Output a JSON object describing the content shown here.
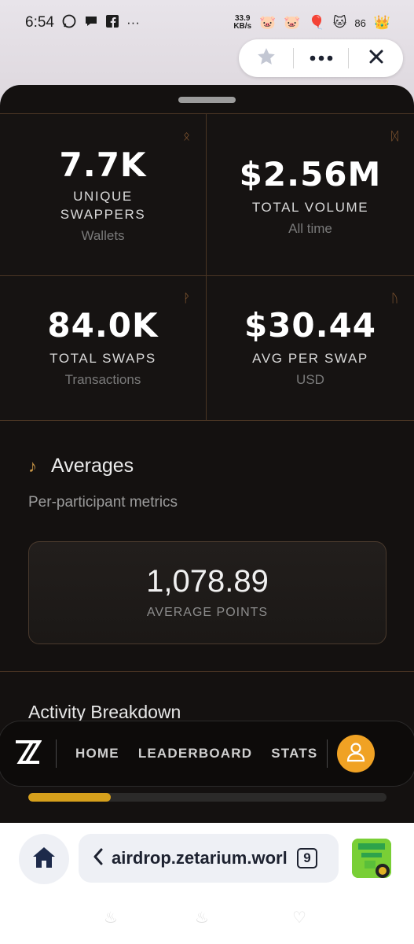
{
  "status_bar": {
    "time": "6:54",
    "net_speed_value": "33.9",
    "net_speed_unit": "KB/s",
    "battery": "86"
  },
  "sheet": {
    "stats": [
      {
        "value": "7.7K",
        "label_line1": "UNIQUE",
        "label_line2": "SWAPPERS",
        "sub": "Wallets",
        "rune": "ᛟ"
      },
      {
        "value": "$2.56M",
        "label_line1": "TOTAL VOLUME",
        "label_line2": "",
        "sub": "All time",
        "rune": "ᛞ"
      },
      {
        "value": "84.0K",
        "label_line1": "TOTAL SWAPS",
        "label_line2": "",
        "sub": "Transactions",
        "rune": "ᚹ"
      },
      {
        "value": "$30.44",
        "label_line1": "AVG PER SWAP",
        "label_line2": "",
        "sub": "USD",
        "rune": "ᚢ"
      }
    ],
    "averages": {
      "title": "Averages",
      "description": "Per-participant metrics",
      "value": "1,078.89",
      "label": "AVERAGE POINTS"
    },
    "activity_title": "Activity Breakdown",
    "nav": {
      "logo": "Z",
      "items": [
        "HOME",
        "LEADERBOARD",
        "STATS"
      ]
    },
    "progress": 0.23
  },
  "browser": {
    "url": "airdrop.zetarium.worl",
    "tab_count": "9"
  }
}
